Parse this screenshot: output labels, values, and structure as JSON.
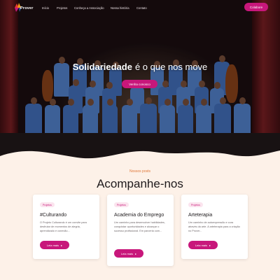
{
  "nav": {
    "logo_text": "Prover",
    "links": [
      "Início",
      "Projetos",
      "Conheça a Associação",
      "Nossa história",
      "Contato"
    ],
    "cta": "Colabore"
  },
  "hero": {
    "title_word1": "Solidariedade",
    "title_rest": "é o que nos move",
    "button": "Venha conosco"
  },
  "posts": {
    "eyebrow": "Nossos posts",
    "title": "Acompanhe-nos",
    "cards": [
      {
        "tag": "Projetos",
        "title": "#Culturando",
        "text": "O Projeto Culturando é um convite para desfrutar de momentos de alegria, aprendizado e conexão...",
        "button": "Leia mais"
      },
      {
        "tag": "Projetos",
        "title": "Academia do Emprego",
        "text": "Um caminho para desenvolver habilidades, conquistar oportunidades e alcançar o sucesso profissional. Em parceria com...",
        "button": "Leia mais"
      },
      {
        "tag": "Projetos",
        "title": "Arteterapia",
        "text": "Um caminho de autoexpressão e cura através da arte. A arteterapia para a criação no Prover...",
        "button": "Leia mais"
      }
    ]
  },
  "colors": {
    "accent": "#c8177b",
    "eyebrow": "#e0783a",
    "background": "#fdf1e8"
  }
}
